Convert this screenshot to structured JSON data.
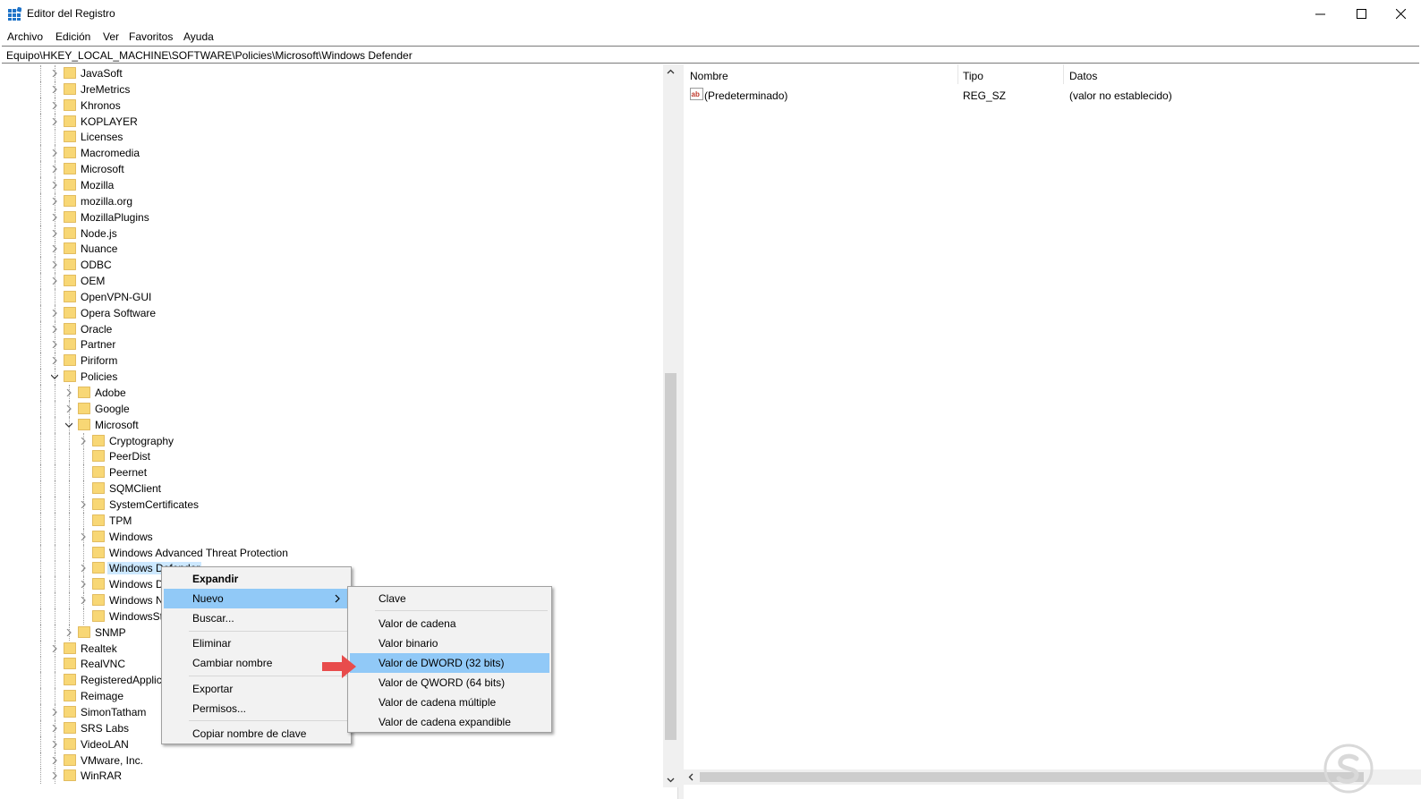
{
  "window": {
    "title": "Editor del Registro",
    "minimize_icon": "minimize-icon",
    "maximize_icon": "maximize-icon",
    "close_icon": "close-icon"
  },
  "menubar": {
    "items": [
      "Archivo",
      "Edición",
      "Ver",
      "Favoritos",
      "Ayuda"
    ]
  },
  "address": {
    "path": "Equipo\\HKEY_LOCAL_MACHINE\\SOFTWARE\\Policies\\Microsoft\\Windows Defender"
  },
  "tree": {
    "items": [
      {
        "label": "JavaSoft",
        "expandable": true
      },
      {
        "label": "JreMetrics",
        "expandable": true
      },
      {
        "label": "Khronos",
        "expandable": true
      },
      {
        "label": "KOPLAYER",
        "expandable": true
      },
      {
        "label": "Licenses",
        "expandable": false
      },
      {
        "label": "Macromedia",
        "expandable": true
      },
      {
        "label": "Microsoft",
        "expandable": true
      },
      {
        "label": "Mozilla",
        "expandable": true
      },
      {
        "label": "mozilla.org",
        "expandable": true
      },
      {
        "label": "MozillaPlugins",
        "expandable": true
      },
      {
        "label": "Node.js",
        "expandable": true
      },
      {
        "label": "Nuance",
        "expandable": true
      },
      {
        "label": "ODBC",
        "expandable": true
      },
      {
        "label": "OEM",
        "expandable": true
      },
      {
        "label": "OpenVPN-GUI",
        "expandable": false
      },
      {
        "label": "Opera Software",
        "expandable": true
      },
      {
        "label": "Oracle",
        "expandable": true
      },
      {
        "label": "Partner",
        "expandable": true
      },
      {
        "label": "Piriform",
        "expandable": true
      },
      {
        "label": "Policies",
        "expandable": true,
        "expanded": true
      },
      {
        "label": "Adobe",
        "expandable": true
      },
      {
        "label": "Google",
        "expandable": true
      },
      {
        "label": "Microsoft",
        "expandable": true,
        "expanded": true
      },
      {
        "label": "Cryptography",
        "expandable": true
      },
      {
        "label": "PeerDist",
        "expandable": false
      },
      {
        "label": "Peernet",
        "expandable": false
      },
      {
        "label": "SQMClient",
        "expandable": false
      },
      {
        "label": "SystemCertificates",
        "expandable": true
      },
      {
        "label": "TPM",
        "expandable": false
      },
      {
        "label": "Windows",
        "expandable": true
      },
      {
        "label": "Windows Advanced Threat Protection",
        "expandable": false
      },
      {
        "label": "Windows Defender",
        "expandable": true,
        "selected": true
      },
      {
        "label": "Windows D",
        "expandable": true
      },
      {
        "label": "Windows N",
        "expandable": true
      },
      {
        "label": "WindowsSt",
        "expandable": false
      },
      {
        "label": "SNMP",
        "expandable": true
      },
      {
        "label": "Realtek",
        "expandable": true
      },
      {
        "label": "RealVNC",
        "expandable": false
      },
      {
        "label": "RegisteredApplica",
        "expandable": false
      },
      {
        "label": "Reimage",
        "expandable": false
      },
      {
        "label": "SimonTatham",
        "expandable": true
      },
      {
        "label": "SRS Labs",
        "expandable": true
      },
      {
        "label": "VideoLAN",
        "expandable": true
      },
      {
        "label": "VMware, Inc.",
        "expandable": true
      },
      {
        "label": "WinRAR",
        "expandable": true
      }
    ]
  },
  "list": {
    "columns": [
      "Nombre",
      "Tipo",
      "Datos"
    ],
    "rows": [
      {
        "name": "(Predeterminado)",
        "type": "REG_SZ",
        "data": "(valor no establecido)",
        "icon": "string-value-icon"
      }
    ]
  },
  "context_menu": {
    "items": [
      "Expandir",
      "Nuevo",
      "Buscar...",
      "Eliminar",
      "Cambiar nombre",
      "Exportar",
      "Permisos...",
      "Copiar nombre de clave"
    ]
  },
  "submenu": {
    "items": [
      "Clave",
      "Valor de cadena",
      "Valor binario",
      "Valor de DWORD (32 bits)",
      "Valor de QWORD (64 bits)",
      "Valor de cadena múltiple",
      "Valor de cadena expandible"
    ]
  },
  "colors": {
    "selection": "#cce8ff",
    "menu_highlight": "#91c9f7",
    "arrow": "#e84c4c",
    "folder": "#f8d775"
  }
}
